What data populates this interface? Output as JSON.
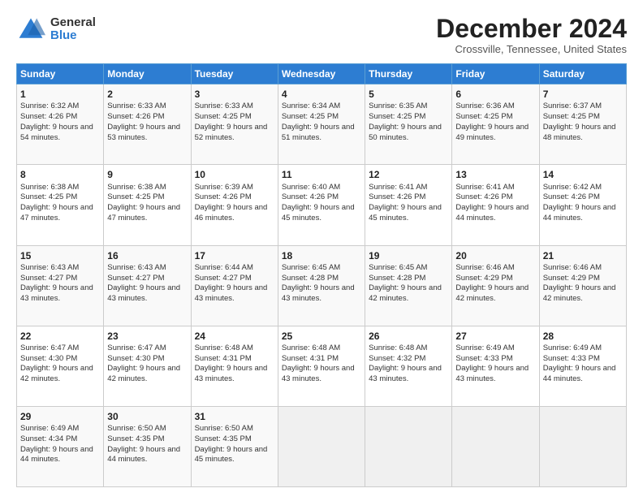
{
  "logo": {
    "general": "General",
    "blue": "Blue"
  },
  "header": {
    "title": "December 2024",
    "subtitle": "Crossville, Tennessee, United States"
  },
  "days_of_week": [
    "Sunday",
    "Monday",
    "Tuesday",
    "Wednesday",
    "Thursday",
    "Friday",
    "Saturday"
  ],
  "weeks": [
    [
      {
        "day": "1",
        "sunrise": "6:32 AM",
        "sunset": "4:26 PM",
        "daylight": "9 hours and 54 minutes."
      },
      {
        "day": "2",
        "sunrise": "6:33 AM",
        "sunset": "4:26 PM",
        "daylight": "9 hours and 53 minutes."
      },
      {
        "day": "3",
        "sunrise": "6:33 AM",
        "sunset": "4:25 PM",
        "daylight": "9 hours and 52 minutes."
      },
      {
        "day": "4",
        "sunrise": "6:34 AM",
        "sunset": "4:25 PM",
        "daylight": "9 hours and 51 minutes."
      },
      {
        "day": "5",
        "sunrise": "6:35 AM",
        "sunset": "4:25 PM",
        "daylight": "9 hours and 50 minutes."
      },
      {
        "day": "6",
        "sunrise": "6:36 AM",
        "sunset": "4:25 PM",
        "daylight": "9 hours and 49 minutes."
      },
      {
        "day": "7",
        "sunrise": "6:37 AM",
        "sunset": "4:25 PM",
        "daylight": "9 hours and 48 minutes."
      }
    ],
    [
      {
        "day": "8",
        "sunrise": "6:38 AM",
        "sunset": "4:25 PM",
        "daylight": "9 hours and 47 minutes."
      },
      {
        "day": "9",
        "sunrise": "6:38 AM",
        "sunset": "4:25 PM",
        "daylight": "9 hours and 47 minutes."
      },
      {
        "day": "10",
        "sunrise": "6:39 AM",
        "sunset": "4:26 PM",
        "daylight": "9 hours and 46 minutes."
      },
      {
        "day": "11",
        "sunrise": "6:40 AM",
        "sunset": "4:26 PM",
        "daylight": "9 hours and 45 minutes."
      },
      {
        "day": "12",
        "sunrise": "6:41 AM",
        "sunset": "4:26 PM",
        "daylight": "9 hours and 45 minutes."
      },
      {
        "day": "13",
        "sunrise": "6:41 AM",
        "sunset": "4:26 PM",
        "daylight": "9 hours and 44 minutes."
      },
      {
        "day": "14",
        "sunrise": "6:42 AM",
        "sunset": "4:26 PM",
        "daylight": "9 hours and 44 minutes."
      }
    ],
    [
      {
        "day": "15",
        "sunrise": "6:43 AM",
        "sunset": "4:27 PM",
        "daylight": "9 hours and 43 minutes."
      },
      {
        "day": "16",
        "sunrise": "6:43 AM",
        "sunset": "4:27 PM",
        "daylight": "9 hours and 43 minutes."
      },
      {
        "day": "17",
        "sunrise": "6:44 AM",
        "sunset": "4:27 PM",
        "daylight": "9 hours and 43 minutes."
      },
      {
        "day": "18",
        "sunrise": "6:45 AM",
        "sunset": "4:28 PM",
        "daylight": "9 hours and 43 minutes."
      },
      {
        "day": "19",
        "sunrise": "6:45 AM",
        "sunset": "4:28 PM",
        "daylight": "9 hours and 42 minutes."
      },
      {
        "day": "20",
        "sunrise": "6:46 AM",
        "sunset": "4:29 PM",
        "daylight": "9 hours and 42 minutes."
      },
      {
        "day": "21",
        "sunrise": "6:46 AM",
        "sunset": "4:29 PM",
        "daylight": "9 hours and 42 minutes."
      }
    ],
    [
      {
        "day": "22",
        "sunrise": "6:47 AM",
        "sunset": "4:30 PM",
        "daylight": "9 hours and 42 minutes."
      },
      {
        "day": "23",
        "sunrise": "6:47 AM",
        "sunset": "4:30 PM",
        "daylight": "9 hours and 42 minutes."
      },
      {
        "day": "24",
        "sunrise": "6:48 AM",
        "sunset": "4:31 PM",
        "daylight": "9 hours and 43 minutes."
      },
      {
        "day": "25",
        "sunrise": "6:48 AM",
        "sunset": "4:31 PM",
        "daylight": "9 hours and 43 minutes."
      },
      {
        "day": "26",
        "sunrise": "6:48 AM",
        "sunset": "4:32 PM",
        "daylight": "9 hours and 43 minutes."
      },
      {
        "day": "27",
        "sunrise": "6:49 AM",
        "sunset": "4:33 PM",
        "daylight": "9 hours and 43 minutes."
      },
      {
        "day": "28",
        "sunrise": "6:49 AM",
        "sunset": "4:33 PM",
        "daylight": "9 hours and 44 minutes."
      }
    ],
    [
      {
        "day": "29",
        "sunrise": "6:49 AM",
        "sunset": "4:34 PM",
        "daylight": "9 hours and 44 minutes."
      },
      {
        "day": "30",
        "sunrise": "6:50 AM",
        "sunset": "4:35 PM",
        "daylight": "9 hours and 44 minutes."
      },
      {
        "day": "31",
        "sunrise": "6:50 AM",
        "sunset": "4:35 PM",
        "daylight": "9 hours and 45 minutes."
      },
      null,
      null,
      null,
      null
    ]
  ],
  "labels": {
    "sunrise": "Sunrise:",
    "sunset": "Sunset:",
    "daylight": "Daylight:"
  }
}
